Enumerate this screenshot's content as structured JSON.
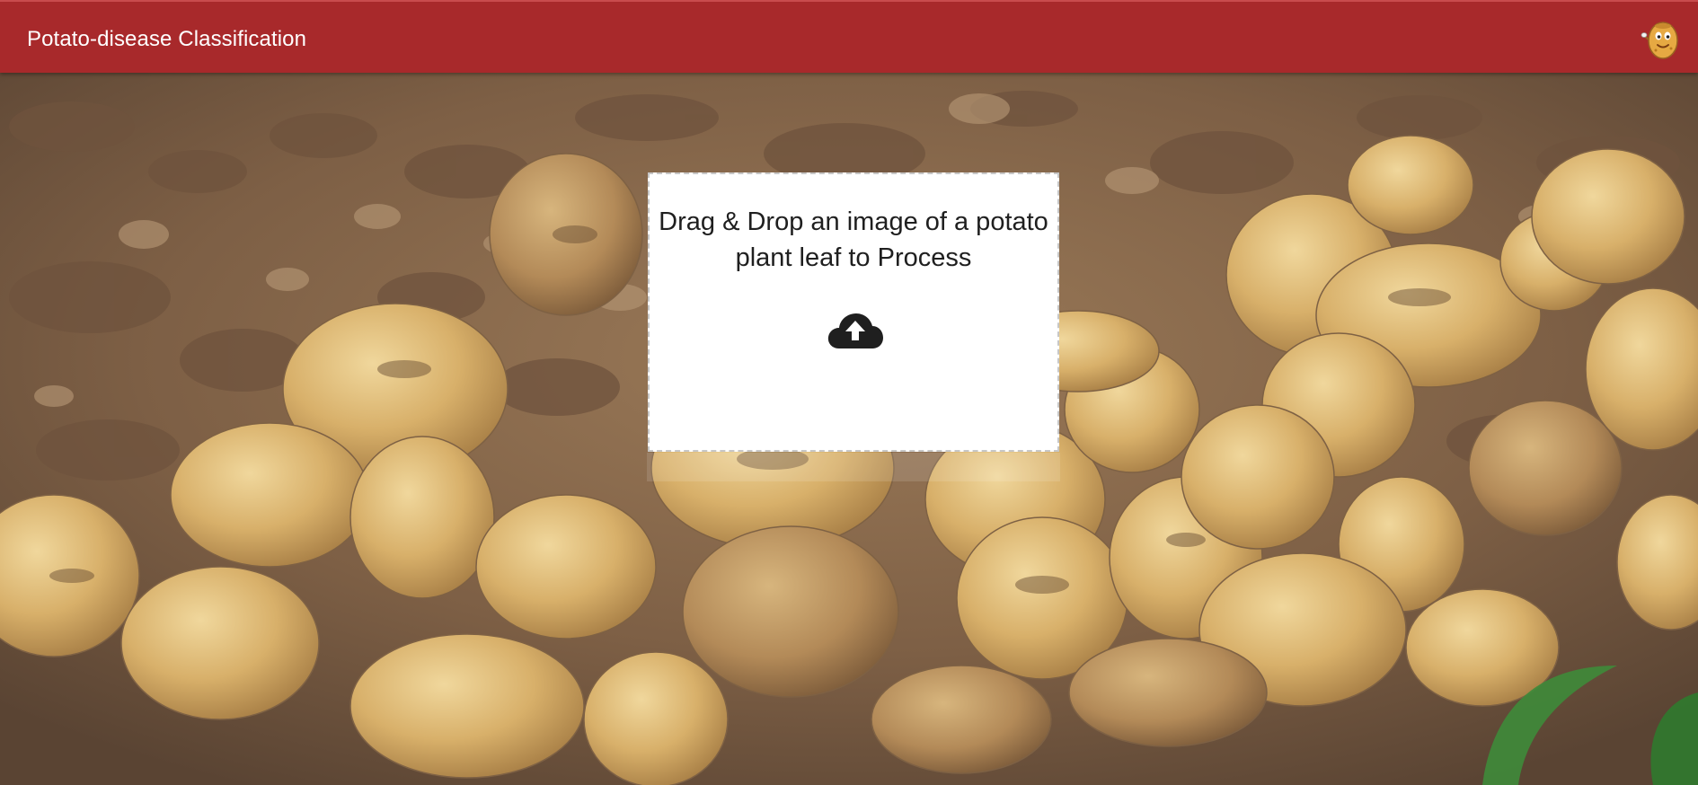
{
  "app": {
    "title": "Potato-disease Classification"
  },
  "dropzone": {
    "instruction": "Drag & Drop an image of a potato plant leaf to Process",
    "icon": "cloud-upload-icon"
  },
  "header": {
    "avatar_icon": "potato-mascot-icon"
  },
  "colors": {
    "appbar": "#a8292b",
    "dropzone_background": "#ffffff",
    "dropzone_border": "#c7c7c7"
  }
}
